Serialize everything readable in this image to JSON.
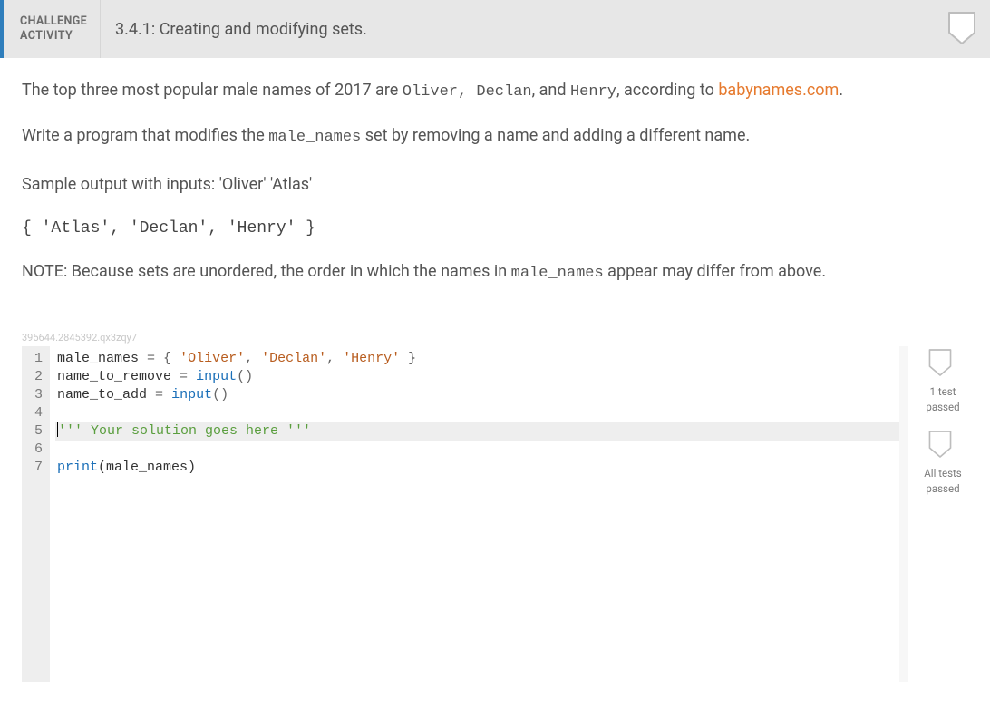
{
  "header": {
    "badge_top": "CHALLENGE",
    "badge_bottom": "ACTIVITY",
    "title": "3.4.1: Creating and modifying sets."
  },
  "intro": {
    "pre": "The top three most popular male names of 2017 are ",
    "name1": "Oliver",
    "sep1": ", ",
    "name2": "Declan",
    "sep2": ", and ",
    "name3": "Henry",
    "post": ", according to ",
    "link_text": "babynames.com",
    "period": "."
  },
  "task": {
    "pre": "Write a program that modifies the ",
    "code": "male_names",
    "post": " set by removing a name and adding a different name."
  },
  "sample_label": "Sample output with inputs: 'Oliver' 'Atlas'",
  "sample_output": "{ 'Atlas', 'Declan', 'Henry' }",
  "note": {
    "pre": "NOTE: Because sets are unordered, the order in which the names in ",
    "code": "male_names",
    "post": " appear may differ from above."
  },
  "watermark": "395644.2845392.qx3zqy7",
  "code_lines": {
    "l1": {
      "a": "male_names",
      "b": " = ",
      "c": "{ ",
      "d": "'Oliver'",
      "e": ", ",
      "f": "'Declan'",
      "g": ", ",
      "h": "'Henry'",
      "i": " }"
    },
    "l2": {
      "a": "name_to_remove",
      "b": " = ",
      "c": "input",
      "d": "()"
    },
    "l3": {
      "a": "name_to_add",
      "b": " = ",
      "c": "input",
      "d": "()"
    },
    "l5": "''' Your solution goes here '''",
    "l7": {
      "a": "print",
      "b": "(male_names)"
    }
  },
  "gutter": [
    "1",
    "2",
    "3",
    "4",
    "5",
    "6",
    "7"
  ],
  "side": {
    "s1a": "1 test",
    "s1b": "passed",
    "s2a": "All tests",
    "s2b": "passed"
  }
}
